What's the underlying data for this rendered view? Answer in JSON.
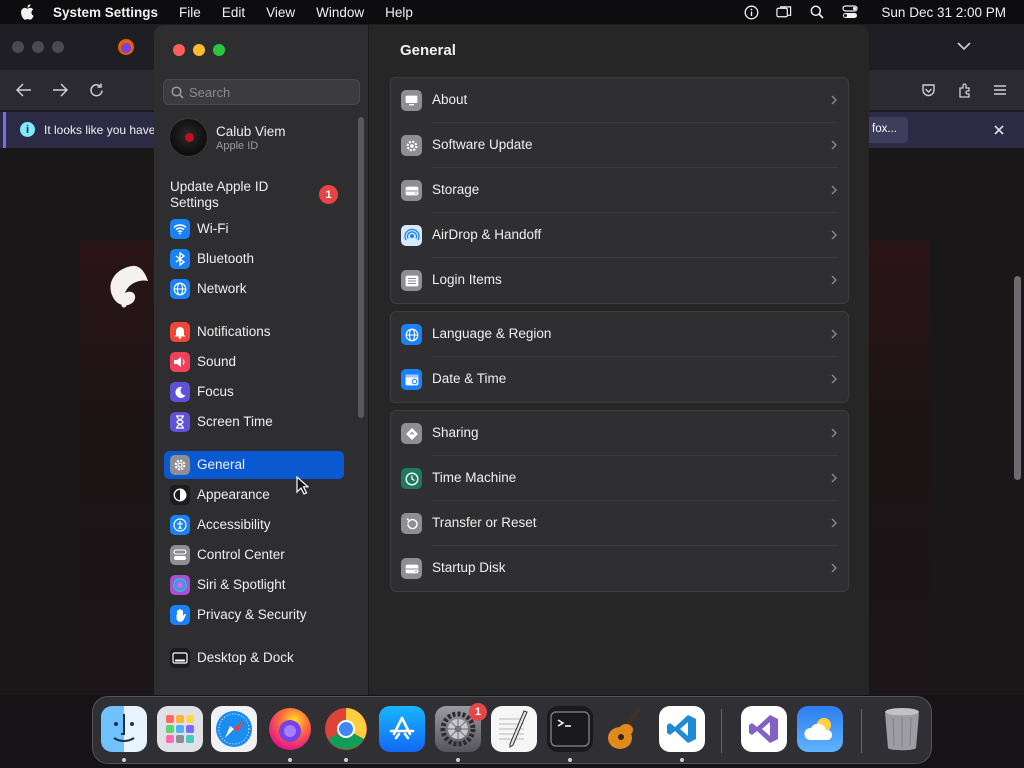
{
  "menubar": {
    "app_name": "System Settings",
    "items": [
      "File",
      "Edit",
      "View",
      "Window",
      "Help"
    ],
    "clock": "Sun Dec 31  2:00 PM"
  },
  "browser": {
    "notification_text": "It looks like you have",
    "notification_button": "fox..."
  },
  "settings": {
    "search_placeholder": "Search",
    "account": {
      "name": "Calub Viem",
      "subtitle": "Apple ID"
    },
    "update_text": "Update Apple ID Settings",
    "update_badge": "1",
    "sidebar_items": [
      {
        "label": "Wi-Fi",
        "icon": "wifi-icon",
        "color": "#1a82f7"
      },
      {
        "label": "Bluetooth",
        "icon": "bluetooth-icon",
        "color": "#1a82f7"
      },
      {
        "label": "Network",
        "icon": "globe-icon",
        "color": "#1a82f7"
      },
      {
        "label": "Notifications",
        "icon": "bell-icon",
        "color": "#f0453a"
      },
      {
        "label": "Sound",
        "icon": "speaker-icon",
        "color": "#f0405a"
      },
      {
        "label": "Focus",
        "icon": "moon-icon",
        "color": "#6251d8"
      },
      {
        "label": "Screen Time",
        "icon": "hourglass-icon",
        "color": "#6251d8"
      },
      {
        "label": "General",
        "icon": "gear-icon",
        "color": "#8e8e93",
        "selected": true
      },
      {
        "label": "Appearance",
        "icon": "appearance-icon",
        "color": "#1c1c1e"
      },
      {
        "label": "Accessibility",
        "icon": "accessibility-icon",
        "color": "#1a82f7"
      },
      {
        "label": "Control Center",
        "icon": "control-center-icon",
        "color": "#8e8e93"
      },
      {
        "label": "Siri & Spotlight",
        "icon": "siri-icon",
        "color": "#a84fd6"
      },
      {
        "label": "Privacy & Security",
        "icon": "hand-icon",
        "color": "#1a82f7"
      },
      {
        "label": "Desktop & Dock",
        "icon": "dock-icon",
        "color": "#1c1c1e"
      }
    ],
    "main_title": "General",
    "groups": [
      [
        {
          "label": "About",
          "icon": "display-icon"
        },
        {
          "label": "Software Update",
          "icon": "gear-badge-icon"
        },
        {
          "label": "Storage",
          "icon": "disk-icon"
        },
        {
          "label": "AirDrop & Handoff",
          "icon": "airdrop-icon"
        },
        {
          "label": "Login Items",
          "icon": "list-icon"
        }
      ],
      [
        {
          "label": "Language & Region",
          "icon": "language-globe-icon"
        },
        {
          "label": "Date & Time",
          "icon": "calendar-clock-icon"
        }
      ],
      [
        {
          "label": "Sharing",
          "icon": "sharing-icon"
        },
        {
          "label": "Time Machine",
          "icon": "time-machine-icon"
        },
        {
          "label": "Transfer or Reset",
          "icon": "reset-icon"
        },
        {
          "label": "Startup Disk",
          "icon": "startup-disk-icon"
        }
      ]
    ]
  },
  "dock": {
    "settings_badge": "1",
    "apps": [
      "Finder",
      "Launchpad",
      "Safari",
      "Firefox",
      "Chrome",
      "App Store",
      "System Settings",
      "TextEdit",
      "Terminal",
      "GarageBand",
      "Visual Studio Code",
      "Visual Studio",
      "Weather",
      "Trash"
    ]
  }
}
